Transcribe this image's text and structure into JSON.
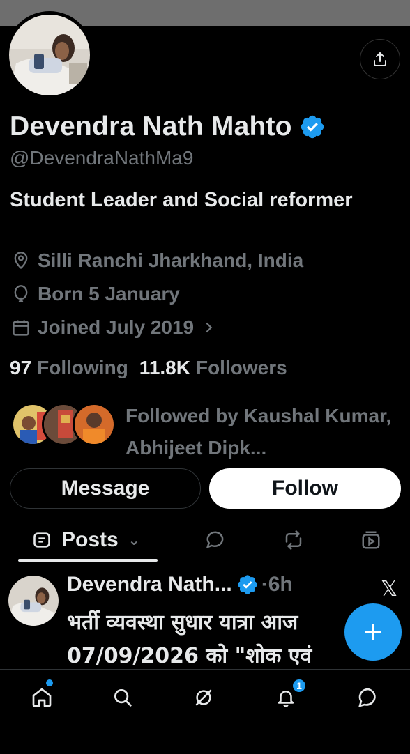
{
  "profile": {
    "name": "Devendra Nath Mahto",
    "handle": "@DevendraNathMa9",
    "bio": "Student Leader and Social reformer",
    "location": "Silli Ranchi Jharkhand, India",
    "born": "Born 5 January",
    "joined": "Joined July 2019",
    "following_count": "97",
    "following_label": "Following",
    "followers_count": "11.8K",
    "followers_label": "Followers",
    "followed_by": "Followed by Kaushal Kumar, Abhijeet Dipk..."
  },
  "actions": {
    "message_label": "Message",
    "follow_label": "Follow"
  },
  "tabs": {
    "posts_label": "Posts"
  },
  "post": {
    "author": "Devendra Nath...",
    "time": "·6h",
    "text": "भर्ती व्यवस्था सुधार यात्रा आज 07/09/2026 को \"शोक एवं"
  },
  "notifications": {
    "badge_count": "1"
  },
  "colors": {
    "accent": "#1d9bf0",
    "muted": "#71767b",
    "text": "#e7e9ea",
    "background": "#000000"
  },
  "icons": [
    "share-icon",
    "verified-badge-icon",
    "location-icon",
    "balloon-icon",
    "calendar-icon",
    "chevron-right-icon",
    "posts-tab-icon",
    "replies-icon",
    "reposts-icon",
    "media-icon",
    "x-logo-icon",
    "plus-icon",
    "home-icon",
    "search-icon",
    "grok-icon",
    "notifications-icon",
    "messages-icon"
  ]
}
